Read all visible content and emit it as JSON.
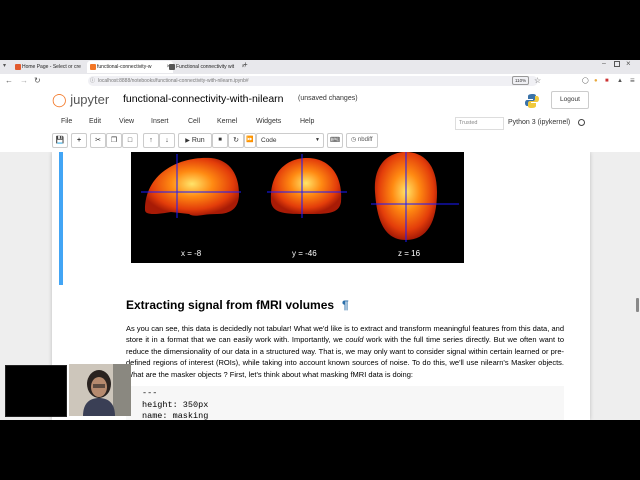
{
  "browser": {
    "tabs": [
      {
        "label": "Home Page - Select or cre",
        "color": "#e25a2d"
      },
      {
        "label": "functional-connectivity-w",
        "color": "#f37726"
      },
      {
        "label": "Functional connectivity wit",
        "color": "#555555"
      }
    ],
    "new_tab": "+",
    "url": "localhost:8888/notebooks/functional-connectivity-with-nilearn.ipynb#",
    "zoom": "110%"
  },
  "jupyter": {
    "logo_text": "jupyter",
    "notebook_title": "functional-connectivity-with-nilearn",
    "save_status": "(unsaved changes)",
    "logout": "Logout",
    "menus": [
      "File",
      "Edit",
      "View",
      "Insert",
      "Cell",
      "Kernel",
      "Widgets",
      "Help"
    ],
    "trusted": "Trusted",
    "kernel": "Python 3 (ipykernel)",
    "run": "Run",
    "cell_type": "Code",
    "nbdiff": "nbdiff"
  },
  "figure": {
    "coords": [
      "x = -8",
      "y = -46",
      "z = 16"
    ]
  },
  "markdown": {
    "heading": "Extracting signal from fMRI volumes",
    "pilcrow": "¶",
    "para_pre": "As you can see, this data is decidedly not tabular! What we'd like is to extract and transform meaningful features from this data, and store it in a format that we can easily work with. Importantly, we ",
    "para_em": "could",
    "para_post": " work with the full time series directly. But we often want to reduce the dimensionality of our data in a structured way. That is, we may only want to consider signal within certain learned or pre-defined regions of interest (ROIs), while taking into account known sources of noise. To do this, we'll use nilearn's Masker objects. What are the masker objects ? First, let's think about what masking fMRI data is doing:"
  },
  "code": {
    "lines": [
      "---",
      "height: 350px",
      "name: masking"
    ]
  },
  "colors": {
    "cell_selected_bar": "#42a5f5",
    "heading_anchor": "#296eaa",
    "jupyter_orange": "#f37726"
  }
}
